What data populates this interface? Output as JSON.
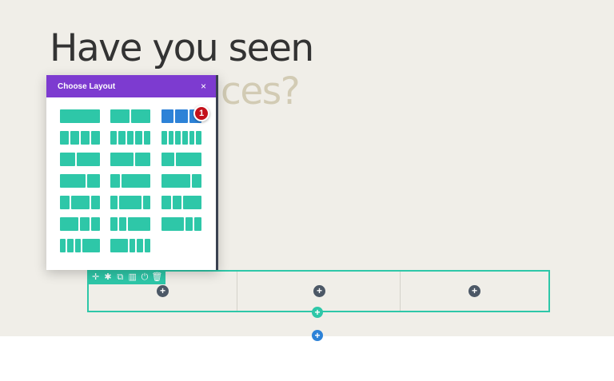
{
  "heading": {
    "line1": "Have you seen",
    "line2": "ces?"
  },
  "modal": {
    "title": "Choose Layout",
    "close_glyph": "×",
    "badge": "1",
    "layouts": [
      {
        "id": "1",
        "cols": [
          1
        ]
      },
      {
        "id": "1_2,1_2",
        "cols": [
          1,
          1
        ]
      },
      {
        "id": "1_3,1_3,1_3",
        "cols": [
          1,
          1,
          1
        ],
        "selected": true
      },
      {
        "id": "1_4x4",
        "cols": [
          1,
          1,
          1,
          1
        ]
      },
      {
        "id": "1_5x5",
        "cols": [
          1,
          1,
          1,
          1,
          1
        ]
      },
      {
        "id": "1_6x6",
        "cols": [
          1,
          1,
          1,
          1,
          1,
          1
        ]
      },
      {
        "id": "2_5,3_5",
        "cols": [
          2,
          3
        ]
      },
      {
        "id": "3_5,2_5",
        "cols": [
          3,
          2
        ]
      },
      {
        "id": "1_3,2_3",
        "cols": [
          1,
          2
        ]
      },
      {
        "id": "2_3,1_3",
        "cols": [
          2,
          1
        ]
      },
      {
        "id": "1_4,3_4",
        "cols": [
          1,
          3
        ]
      },
      {
        "id": "3_4,1_4",
        "cols": [
          3,
          1
        ]
      },
      {
        "id": "1_4,1_2,1_4",
        "cols": [
          1,
          2,
          1
        ]
      },
      {
        "id": "1_5,3_5,1_5",
        "cols": [
          1,
          3,
          1
        ]
      },
      {
        "id": "1_4,1_4,1_2",
        "cols": [
          1,
          1,
          2
        ]
      },
      {
        "id": "1_2,1_4,1_4",
        "cols": [
          2,
          1,
          1
        ]
      },
      {
        "id": "1_5,1_5,3_5",
        "cols": [
          1,
          1,
          3
        ]
      },
      {
        "id": "3_5,1_5,1_5",
        "cols": [
          3,
          1,
          1
        ]
      },
      {
        "id": "1_6,1_6,1_6,1_2",
        "cols": [
          1,
          1,
          1,
          3
        ]
      },
      {
        "id": "1_2,1_6,1_6,1_6",
        "cols": [
          3,
          1,
          1,
          1
        ]
      }
    ]
  },
  "row": {
    "toolbar_icons": [
      {
        "name": "move-icon",
        "glyph": "✛"
      },
      {
        "name": "gear-icon",
        "glyph": "✱"
      },
      {
        "name": "duplicate-icon",
        "glyph": "⧉"
      },
      {
        "name": "columns-icon",
        "glyph": "▥"
      },
      {
        "name": "power-icon",
        "glyph": "⏻"
      },
      {
        "name": "trash-icon",
        "glyph": "🗑"
      }
    ],
    "column_add_glyph": "+"
  },
  "buttons": {
    "add_row_glyph": "+",
    "add_section_glyph": "+"
  },
  "colors": {
    "accent": "#2ec7a8",
    "header": "#7d3bd0",
    "selected": "#2d82d7",
    "badge": "#c4101a"
  }
}
